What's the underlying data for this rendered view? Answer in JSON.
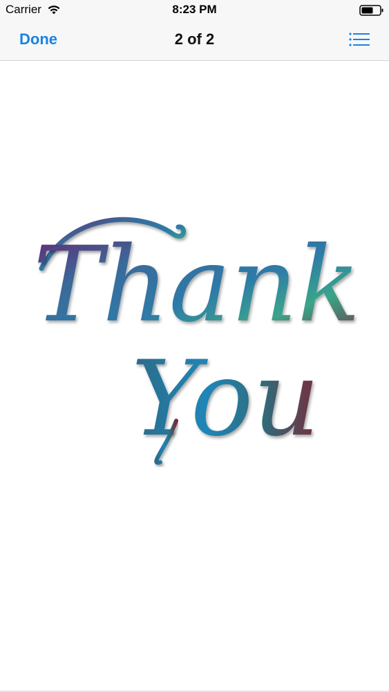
{
  "status_bar": {
    "carrier": "Carrier",
    "time": "8:23 PM",
    "wifi_icon": "wifi-icon",
    "battery_icon": "battery-icon"
  },
  "nav_bar": {
    "done_label": "Done",
    "title": "2 of 2",
    "list_icon": "list-icon",
    "accent_color": "#1a82e0"
  },
  "artwork": {
    "line1": "Thank",
    "line2": "You",
    "gradient_colors": [
      "#6a1f6e",
      "#3a6a9a",
      "#2d7aa8",
      "#3aa58a",
      "#7a2a3a"
    ]
  }
}
